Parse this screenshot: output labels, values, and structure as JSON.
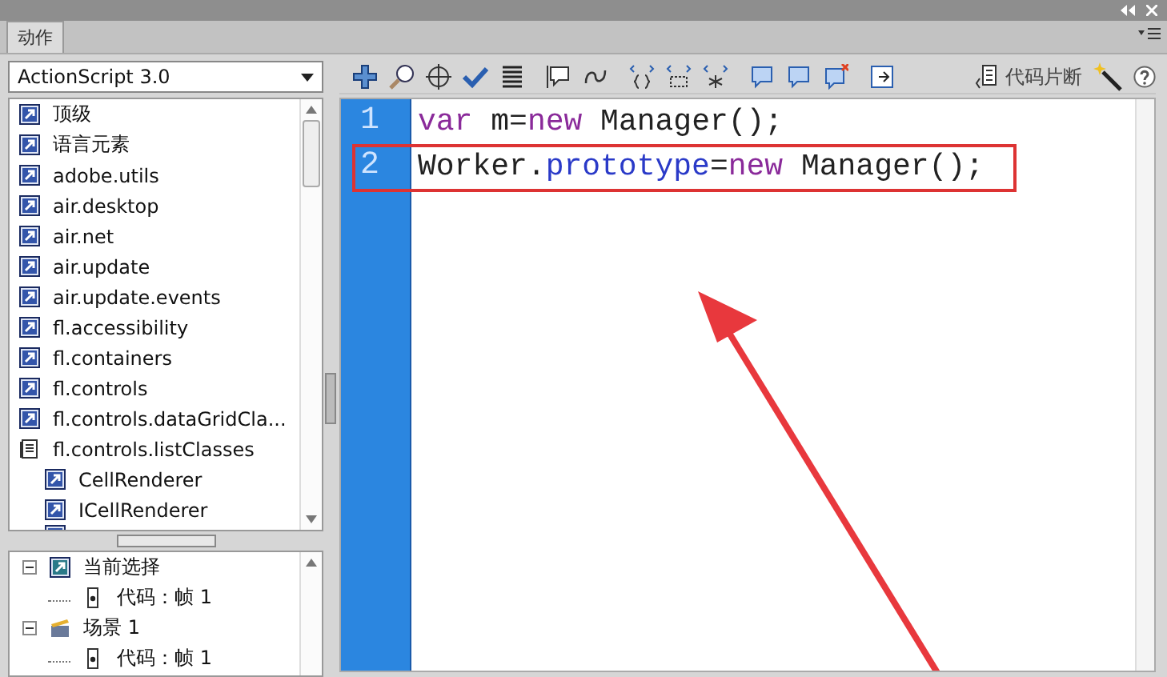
{
  "panel": {
    "tab": {
      "label": "动作",
      "selected": true
    }
  },
  "language_select": {
    "value": "ActionScript 3.0"
  },
  "library": [
    {
      "label": "顶级",
      "kind": "package"
    },
    {
      "label": "语言元素",
      "kind": "package"
    },
    {
      "label": "adobe.utils",
      "kind": "package"
    },
    {
      "label": "air.desktop",
      "kind": "package"
    },
    {
      "label": "air.net",
      "kind": "package"
    },
    {
      "label": "air.update",
      "kind": "package"
    },
    {
      "label": "air.update.events",
      "kind": "package"
    },
    {
      "label": "fl.accessibility",
      "kind": "package"
    },
    {
      "label": "fl.containers",
      "kind": "package"
    },
    {
      "label": "fl.controls",
      "kind": "package"
    },
    {
      "label": "fl.controls.dataGridCla...",
      "kind": "package"
    },
    {
      "label": "fl.controls.listClasses",
      "kind": "book",
      "children": [
        {
          "label": "CellRenderer",
          "kind": "package"
        },
        {
          "label": "ICellRenderer",
          "kind": "package"
        }
      ]
    }
  ],
  "script_tree": [
    {
      "label": "当前选择",
      "kind": "selection",
      "expanded": true,
      "children": [
        {
          "label": "代码：帧 1",
          "kind": "frame"
        }
      ]
    },
    {
      "label": "场景 1",
      "kind": "scene",
      "expanded": true,
      "children": [
        {
          "label": "代码：帧 1",
          "kind": "frame"
        }
      ]
    }
  ],
  "toolbar": {
    "snippets_label": "代码片断"
  },
  "code_lines": [
    {
      "number": "1",
      "highlighted": false,
      "tokens": [
        {
          "text": "var",
          "kind": "keyword"
        },
        {
          "text": " m=",
          "kind": "plain"
        },
        {
          "text": "new",
          "kind": "keyword"
        },
        {
          "text": " Manager();",
          "kind": "plain"
        }
      ]
    },
    {
      "number": "2",
      "highlighted": true,
      "tokens": [
        {
          "text": "Worker.",
          "kind": "plain"
        },
        {
          "text": "prototype",
          "kind": "property"
        },
        {
          "text": "=",
          "kind": "plain"
        },
        {
          "text": "new",
          "kind": "keyword"
        },
        {
          "text": " Manager();",
          "kind": "plain"
        }
      ]
    }
  ]
}
